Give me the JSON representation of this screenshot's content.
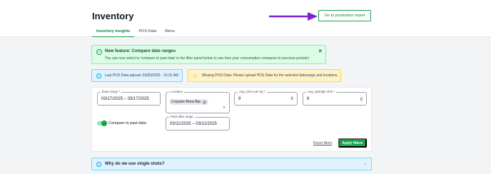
{
  "header": {
    "title": "Inventory",
    "production_report_label": "Go to production report"
  },
  "tabs": [
    {
      "label": "Inventory insights",
      "active": true
    },
    {
      "label": "POS Data",
      "active": false
    },
    {
      "label": "Menu",
      "active": false
    }
  ],
  "feature_banner": {
    "title": "New feature: Compare date ranges",
    "body": "You can now select to 'compare to past data' in the filter panel below to see how your consumption compares to previous periods!",
    "close_icon": "×"
  },
  "info_notice": {
    "text": "Last POS Data upload: 03/25/2025 - 10:31 AM"
  },
  "warning_notice": {
    "text": "Missing POS Data: Please upload POS Data for the selected daterange and locations."
  },
  "filters": {
    "date_range": {
      "label": "Date range *",
      "value": "03/17/2025 – 03/17/2025"
    },
    "location": {
      "label": "Location",
      "chip": "Cropster Brew Bar"
    },
    "avg_price": {
      "label": "Avg. price per kg *",
      "value": "9",
      "unit": "€"
    },
    "avg_grams": {
      "label": "Avg. g/single shot *",
      "value": "9",
      "unit": "g"
    },
    "past_date_range": {
      "label": "Past date range",
      "value": "03/11/2025 – 03/11/2025"
    },
    "compare_toggle": {
      "label": "Compare to past data",
      "on": true
    },
    "reset_label": "Reset filters",
    "apply_label": "Apply filters"
  },
  "faq": {
    "title": "Why do we use single shots?"
  },
  "colors": {
    "accent": "#16a34a",
    "arrow": "#7e22ce"
  }
}
